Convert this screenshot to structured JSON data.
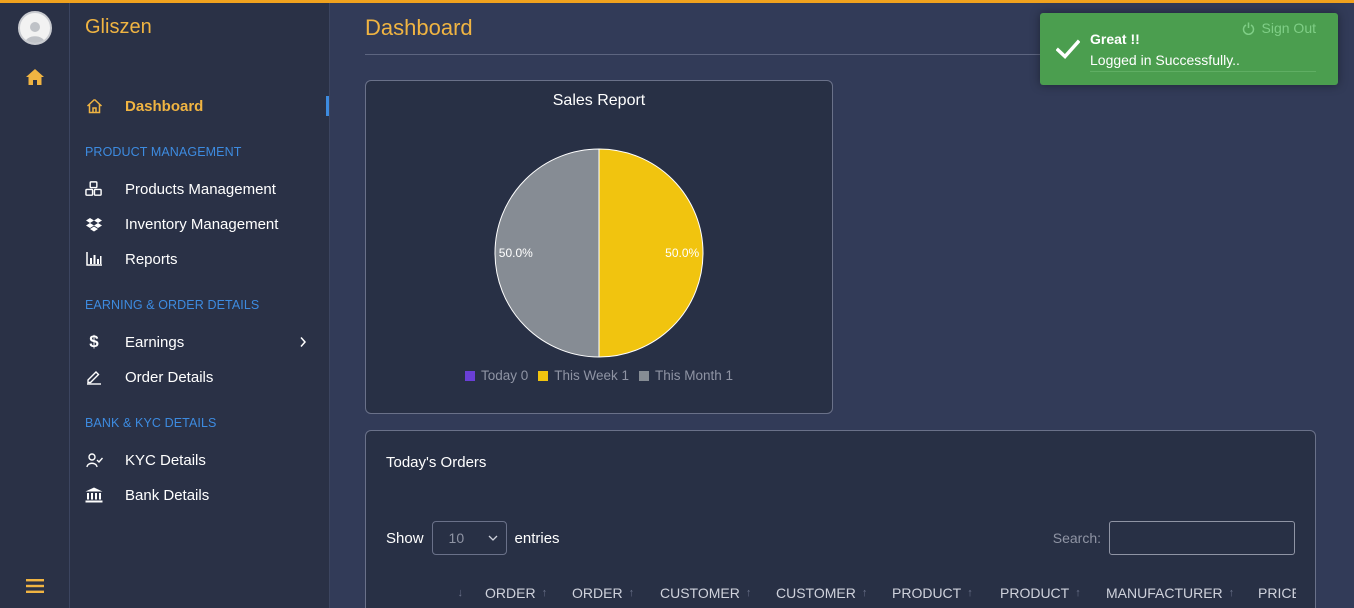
{
  "app": {
    "name": "Gliszen"
  },
  "page": {
    "title": "Dashboard"
  },
  "sidebar": {
    "dashboard": "Dashboard",
    "sections": [
      {
        "heading": "PRODUCT MANAGEMENT",
        "items": [
          "Products Management",
          "Inventory Management",
          "Reports"
        ]
      },
      {
        "heading": "EARNING & ORDER DETAILS",
        "items": [
          "Earnings",
          "Order Details"
        ]
      },
      {
        "heading": "BANK & KYC DETAILS",
        "items": [
          "KYC Details",
          "Bank Details"
        ]
      }
    ]
  },
  "icons": {
    "rail": [
      "avatar-icon",
      "home-icon",
      "menu-icon"
    ],
    "nav": [
      "home-outline-icon",
      "cubes-icon",
      "dropbox-icon",
      "bar-chart-icon",
      "dollar-icon",
      "edit-icon",
      "user-check-icon",
      "bank-icon"
    ]
  },
  "colors": {
    "accent": "#f0b442",
    "link": "#3d8be0",
    "topbar": "#f0a21e",
    "toast": "#4b9e4f"
  },
  "chart_data": {
    "type": "pie",
    "title": "Sales Report",
    "labels": [
      "Today",
      "This Week",
      "This Month"
    ],
    "values": [
      0,
      1,
      1
    ],
    "colors": [
      "#6a3fd6",
      "#f1c40f",
      "#868c94"
    ],
    "data_labels": [
      "50.0%",
      "50.0%"
    ],
    "legend": {
      "placement": "bottom",
      "entries": [
        "Today 0",
        "This Week 1",
        "This Month 1"
      ]
    }
  },
  "orders": {
    "title": "Today's Orders",
    "show_label": "Show",
    "entries_value": "10",
    "entries_label": "entries",
    "search_label": "Search:",
    "columns": [
      "ORDER",
      "ORDER",
      "CUSTOMER",
      "CUSTOMER",
      "PRODUCT",
      "PRODUCT",
      "MANUFACTURER",
      "PRICE"
    ]
  },
  "toast": {
    "title": "Great !!",
    "message": "Logged in Successfully..",
    "sign_out": "Sign Out"
  }
}
